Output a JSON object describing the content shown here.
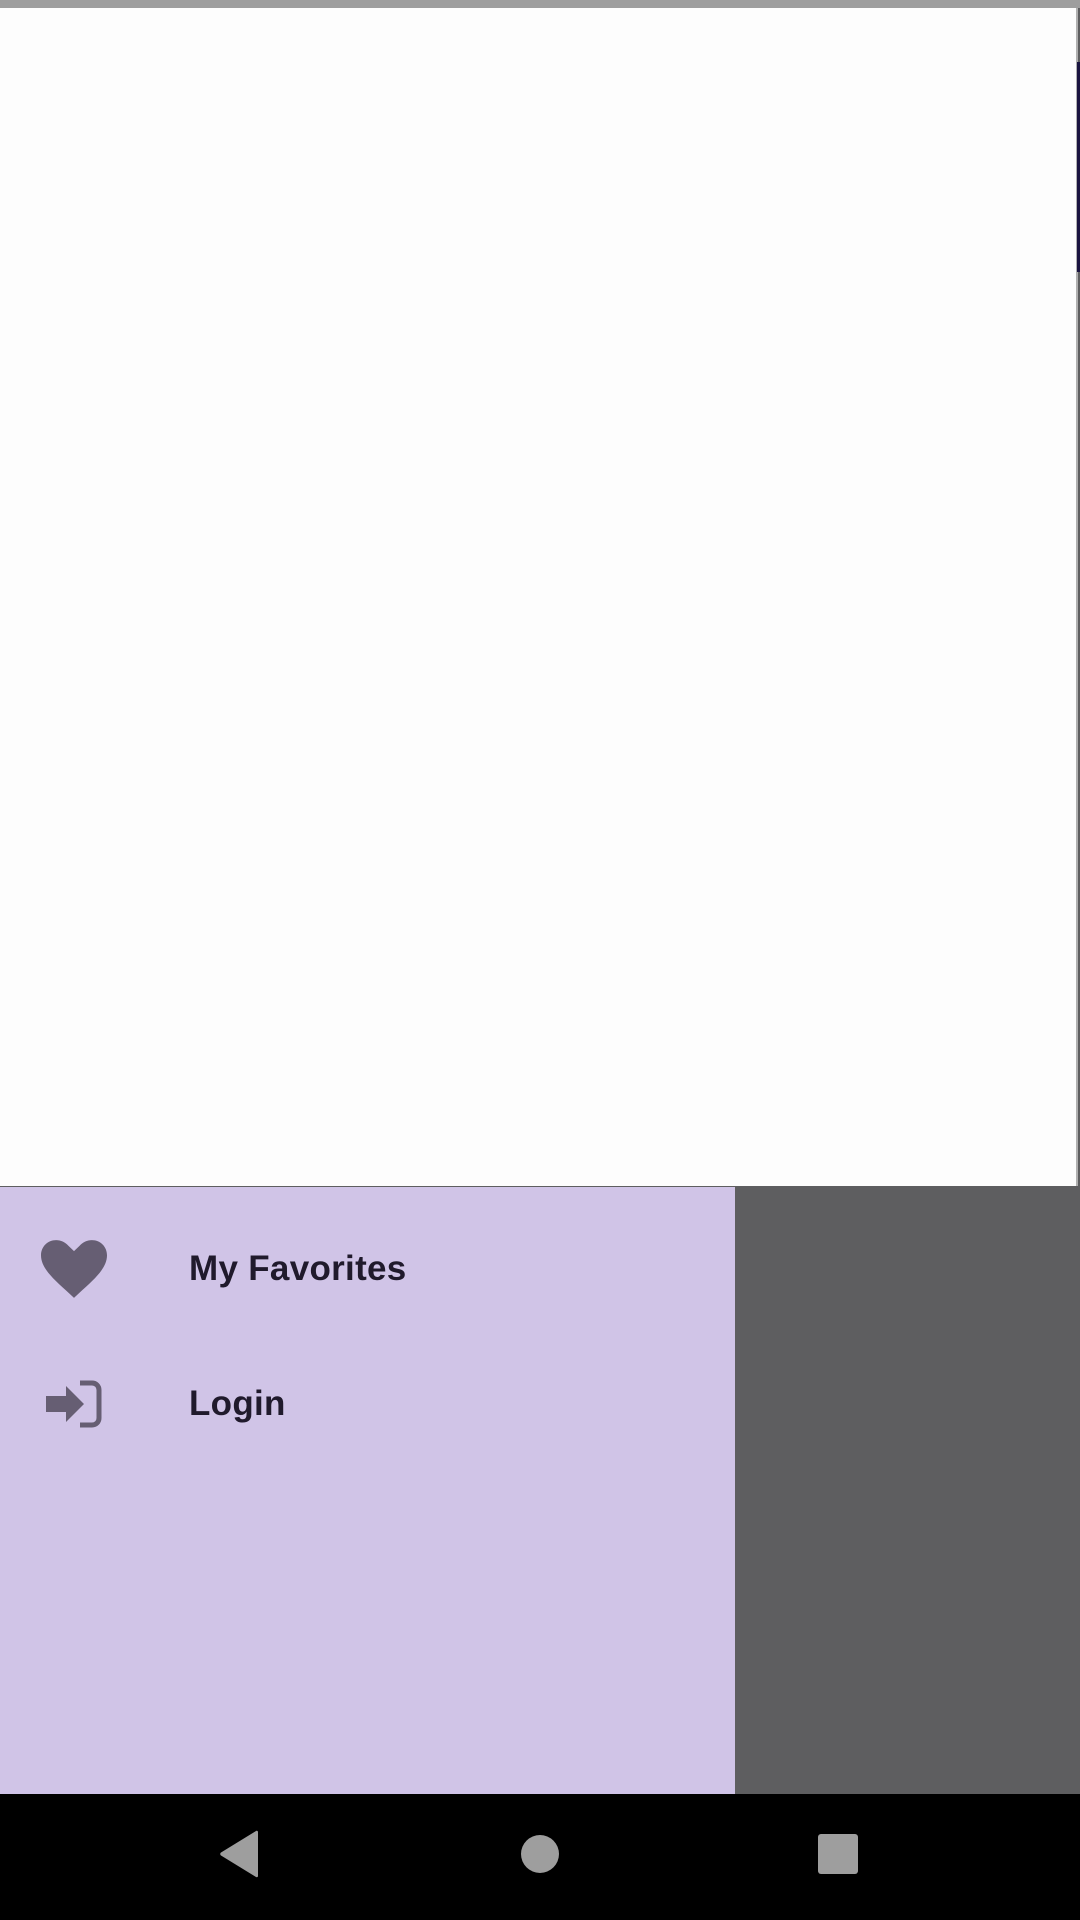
{
  "drawer": {
    "items": [
      {
        "label": "My Favorites",
        "icon": "heart-icon"
      },
      {
        "label": "Login",
        "icon": "login-icon"
      }
    ]
  },
  "nav": {
    "back": "back-icon",
    "home": "home-icon",
    "recents": "recents-icon"
  },
  "colors": {
    "drawer_bg": "#d0c4e7",
    "scrim": "#5e5e60",
    "icon": "#665e73",
    "label": "#201a2c",
    "nav_bg": "#000000",
    "nav_icon": "#9e9e9e"
  }
}
